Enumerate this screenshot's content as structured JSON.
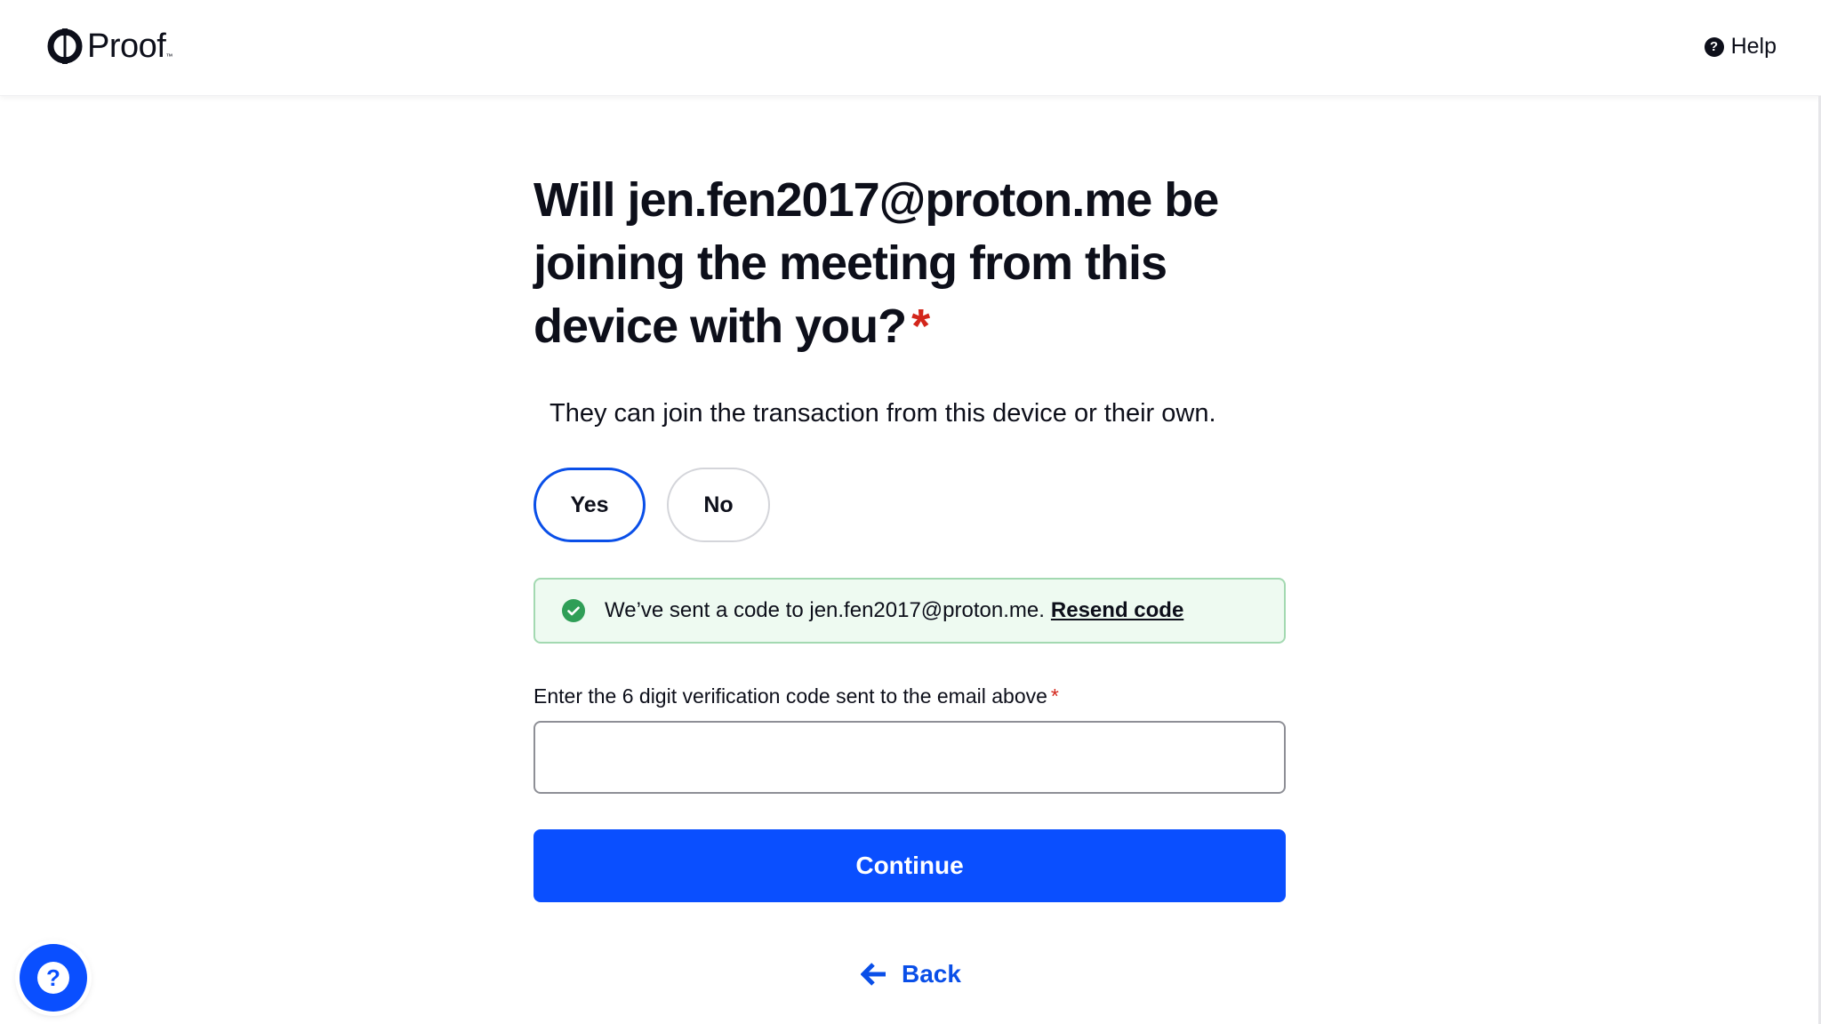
{
  "header": {
    "brand": "Proof",
    "brand_tm": "™",
    "help_label": "Help",
    "help_icon_glyph": "?"
  },
  "main": {
    "headline": "Will jen.fen2017@proton.me be joining the meeting from this device with you?",
    "required_mark": "*",
    "subtext": "They can join the transaction from this device or their own.",
    "options": [
      {
        "label": "Yes",
        "selected": true
      },
      {
        "label": "No",
        "selected": false
      }
    ],
    "alert": {
      "icon": "check-circle-icon",
      "message": "We’ve sent a code to jen.fen2017@proton.me.",
      "resend_label": "Resend code"
    },
    "code_field": {
      "label": "Enter the 6 digit verification code sent to the email above",
      "required_mark": "*",
      "value": ""
    },
    "continue_label": "Continue",
    "back_label": "Back"
  },
  "support_fab": {
    "icon": "question-icon",
    "glyph": "?"
  },
  "colors": {
    "accent": "#0a4fff",
    "required": "#d3261b",
    "success": "#2f9e57",
    "success_bg": "#eefaf1"
  }
}
